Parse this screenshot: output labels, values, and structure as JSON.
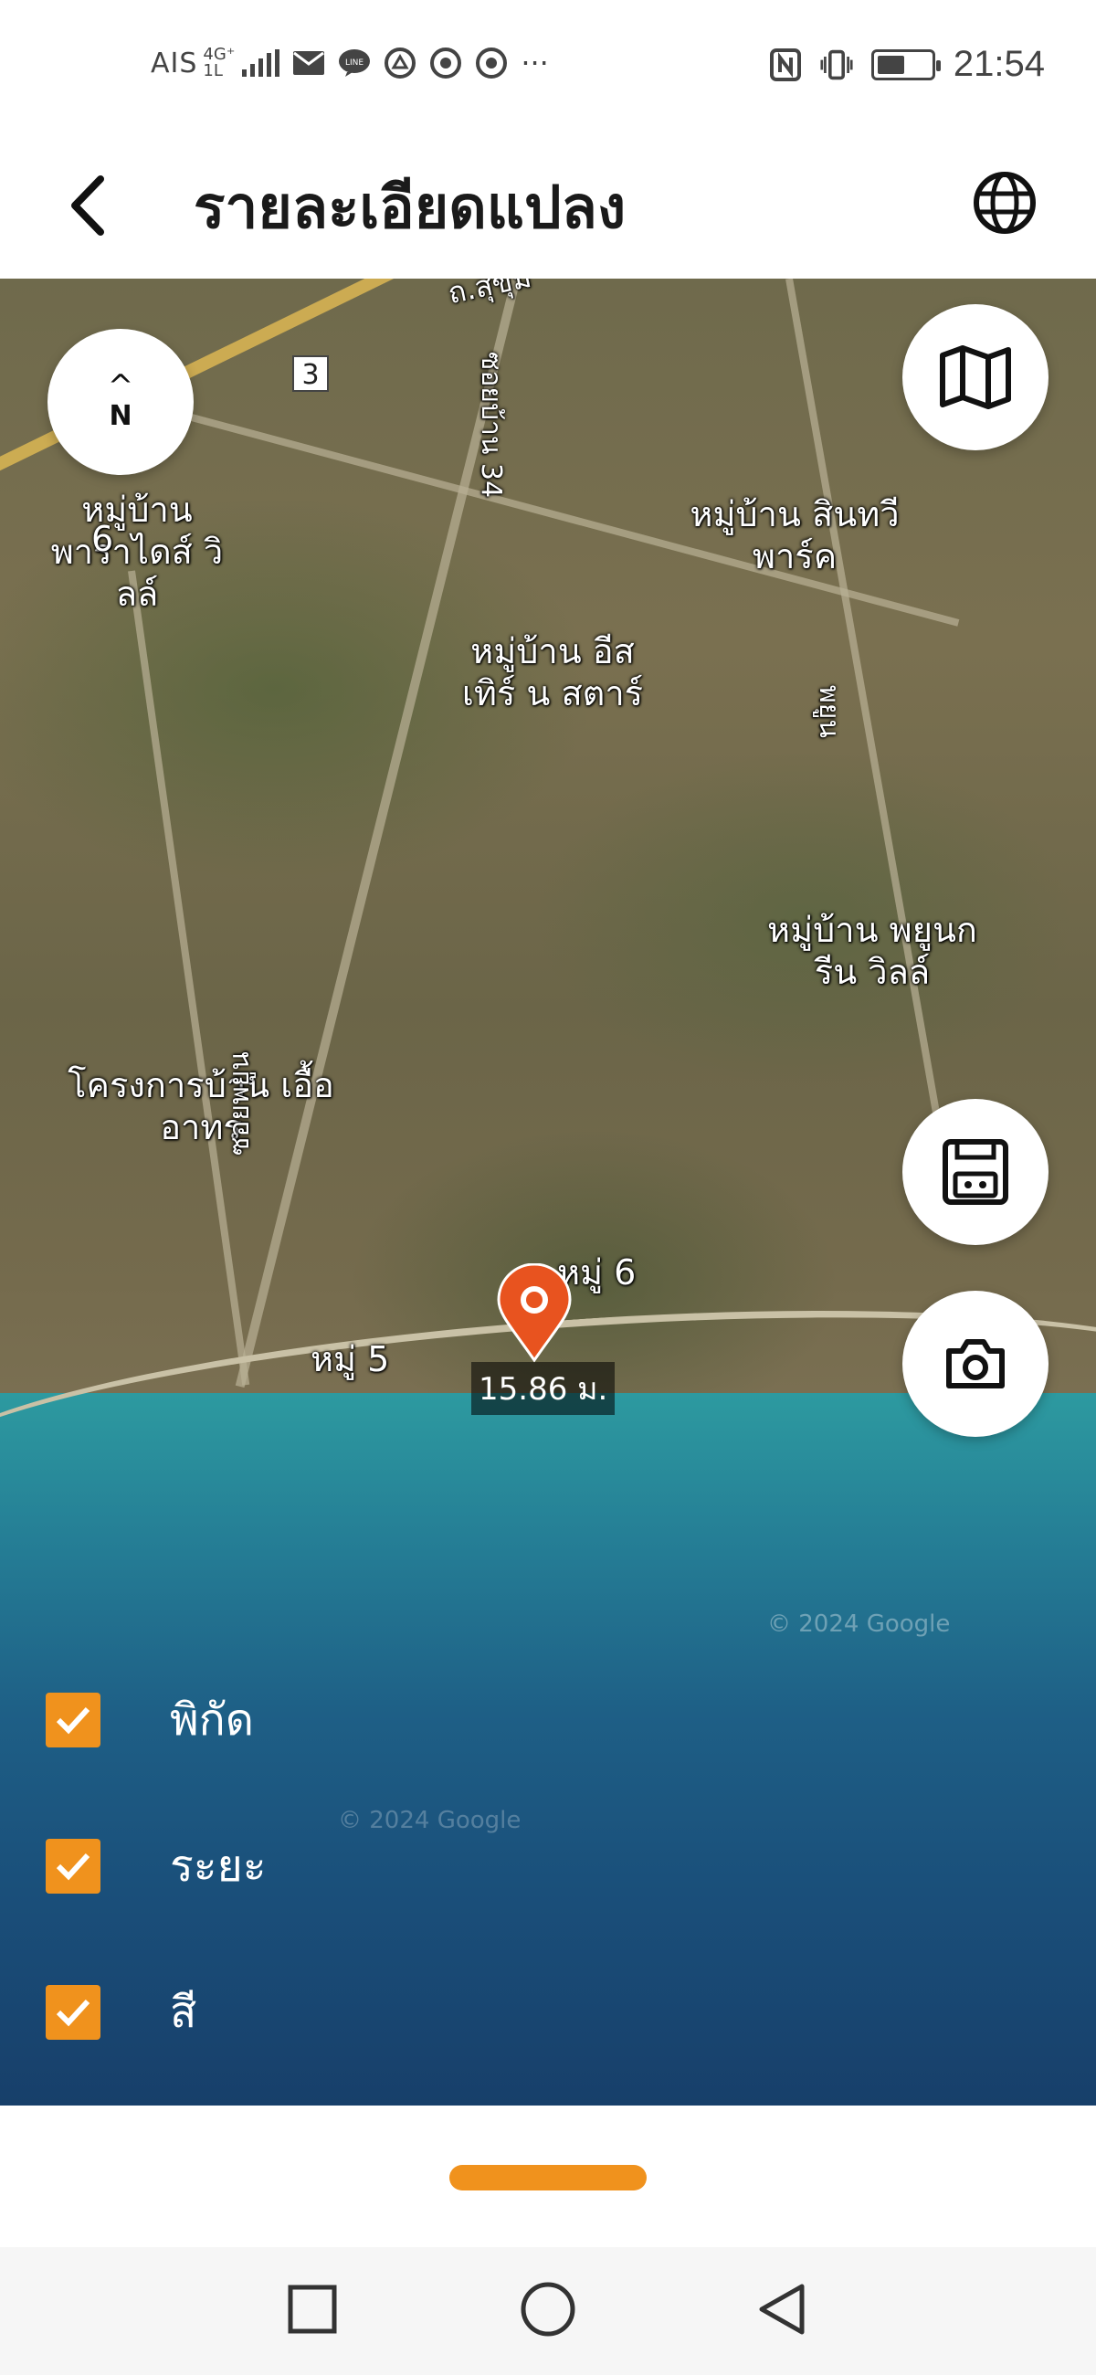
{
  "status_bar": {
    "carrier": "AIS",
    "network_top": "4G⁺",
    "network_bottom": "1L",
    "time": "21:54",
    "battery_level": 0.45,
    "icons": [
      "mail-icon",
      "line-icon",
      "app-icon",
      "chrome-icon",
      "chrome-icon",
      "more-icon",
      "nfc-icon",
      "vibrate-icon",
      "battery-icon"
    ],
    "more": "···"
  },
  "header": {
    "title": "รายละเอียดแปลง",
    "back_icon": "chevron-left-icon",
    "globe_icon": "globe-icon"
  },
  "map": {
    "compass": {
      "arrow": "^",
      "label": "N"
    },
    "labels": [
      "ถ.สุขุม",
      "3",
      "หมู่บ้าน พาราไดส์ วิลล์",
      "6",
      "หมู่บ้าน สินทวี พาร์ค",
      "หมู่บ้าน อีสเทิร์ น สตาร์",
      "หมู่บ้าน พยูนกรีน วิลล์",
      "โครงการบ้าน เอื้ออาทร",
      "หมู่ 6",
      "หมู่ 5",
      "ซอยบ้าน 34",
      "พยูน",
      "ซอยพยูน",
      "© 2024 Google"
    ],
    "marker_distance": "15.86 ม."
  },
  "map_buttons": {
    "layers_icon": "map-icon",
    "save_icon": "floppy-icon",
    "camera_icon": "camera-icon"
  },
  "options": [
    {
      "label": "พิกัด",
      "checked": true
    },
    {
      "label": "ระยะ",
      "checked": true
    },
    {
      "label": "สี",
      "checked": true
    }
  ],
  "colors": {
    "accent": "#f0921d",
    "pin": "#e8531f"
  }
}
